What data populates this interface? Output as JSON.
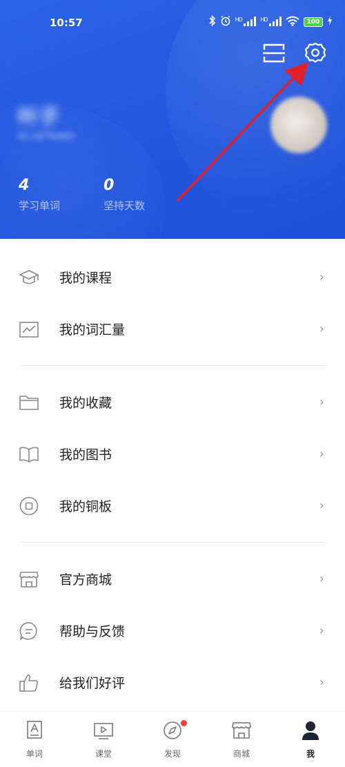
{
  "status_bar": {
    "time": "10:57",
    "battery": "100",
    "signal1": "HD",
    "signal2": "HD"
  },
  "header": {
    "username": "叶子",
    "user_id": "ID:1876485",
    "stats": [
      {
        "value": "4",
        "label": "学习单词"
      },
      {
        "value": "0",
        "label": "坚持天数"
      }
    ]
  },
  "menu": {
    "group1": [
      {
        "label": "我的课程",
        "icon": "graduation-cap-icon"
      },
      {
        "label": "我的词汇量",
        "icon": "chart-icon"
      }
    ],
    "group2": [
      {
        "label": "我的收藏",
        "icon": "folder-icon"
      },
      {
        "label": "我的图书",
        "icon": "book-icon"
      },
      {
        "label": "我的铜板",
        "icon": "coin-icon"
      }
    ],
    "group3": [
      {
        "label": "官方商城",
        "icon": "store-icon"
      },
      {
        "label": "帮助与反馈",
        "icon": "chat-icon"
      },
      {
        "label": "给我们好评",
        "icon": "thumbs-up-icon"
      }
    ],
    "chevron": "›"
  },
  "tabbar": {
    "tabs": [
      {
        "label": "单词",
        "icon": "word-card-icon"
      },
      {
        "label": "课堂",
        "icon": "video-icon"
      },
      {
        "label": "发现",
        "icon": "compass-icon"
      },
      {
        "label": "商城",
        "icon": "store-icon"
      },
      {
        "label": "我",
        "icon": "person-icon"
      }
    ],
    "active_index": 4
  },
  "colors": {
    "header_blue": "#2458e0",
    "accent_red_dot": "#f03b3b",
    "annotation_arrow": "#e0202a"
  }
}
